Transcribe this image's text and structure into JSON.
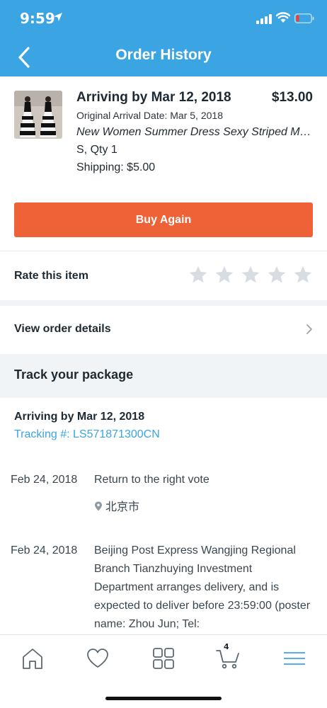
{
  "status_bar": {
    "time": "9:59"
  },
  "nav": {
    "title": "Order History"
  },
  "order": {
    "arriving": "Arriving by Mar 12, 2018",
    "price": "$13.00",
    "original_arrival": "Original Arrival Date: Mar 5, 2018",
    "product_name": "New Women Summer Dress Sexy Striped Maxi Dress",
    "size_qty": "S, Qty 1",
    "shipping": "Shipping: $5.00",
    "buy_again_label": "Buy Again"
  },
  "rating": {
    "label": "Rate this item",
    "stars_filled": 0,
    "stars_total": 5
  },
  "view_details": {
    "label": "View order details"
  },
  "tracking": {
    "title": "Track your package",
    "arriving": "Arriving by Mar 12, 2018",
    "tracking_number": "Tracking #: LS571871300CN",
    "events": [
      {
        "date": "Feb 24, 2018",
        "description": "Return to the right vote",
        "location": "北京市"
      },
      {
        "date": "Feb 24, 2018",
        "description": "Beijing Post Express Wangjing Regional Branch Tianzhuying Investment Department arranges delivery, and is expected to deliver before 23:59:00 (poster name: Zhou Jun; Tel:"
      }
    ]
  },
  "tab_bar": {
    "cart_count": "4",
    "active_tab": "menu"
  },
  "colors": {
    "header": "#3ba4e2",
    "accent": "#ef6136",
    "link": "#3ba4e2"
  },
  "icons": [
    "back-chevron",
    "star",
    "chevron-right",
    "map-pin",
    "home",
    "heart",
    "grid",
    "cart",
    "menu"
  ]
}
